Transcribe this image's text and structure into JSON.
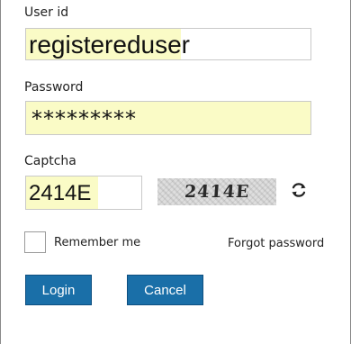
{
  "form": {
    "userid": {
      "label": "User id",
      "value": "registereduser"
    },
    "password": {
      "label": "Password",
      "value": "*********"
    },
    "captcha": {
      "label": "Captcha",
      "value": "2414E",
      "image_text": "2414E"
    },
    "remember_label": "Remember me",
    "forgot_label": "Forgot password",
    "login_label": "Login",
    "cancel_label": "Cancel"
  },
  "icons": {
    "refresh": "refresh-icon",
    "checkbox": "checkbox-unchecked"
  },
  "colors": {
    "autofill_highlight": "#fafbc6",
    "button_background": "#1a6fa8",
    "button_text": "#ffffff",
    "field_border": "#c9c9c9"
  }
}
